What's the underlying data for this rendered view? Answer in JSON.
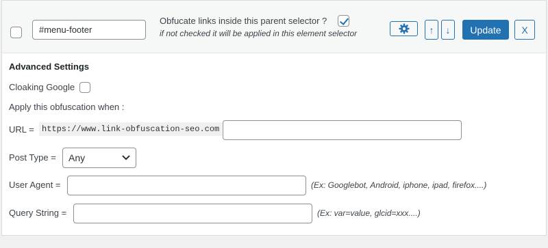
{
  "row": {
    "selector_value": "#menu-footer",
    "parent_selector_label": "Obfucate links inside this parent selector ?",
    "parent_selector_hint": "if not checked it will be applied in this element selector",
    "parent_selector_checked": true,
    "update_label": "Update",
    "close_label": "X",
    "up_arrow": "↑",
    "down_arrow": "↓",
    "settings_icon": "gear-icon"
  },
  "advanced": {
    "heading": "Advanced Settings",
    "cloaking_label": "Cloaking Google",
    "cloaking_checked": false,
    "apply_when_label": "Apply this obfuscation when :",
    "url_label": "URL =",
    "url_prefix": "https://www.link-obfuscation-seo.com",
    "url_value": "",
    "post_type_label": "Post Type =",
    "post_type_selected": "Any",
    "user_agent_label": "User Agent =",
    "user_agent_value": "",
    "user_agent_hint": "(Ex: Googlebot, Android, iphone, ipad, firefox....)",
    "query_string_label": "Query String =",
    "query_string_value": "",
    "query_string_hint": "(Ex: var=value, glcid=xxx....)"
  },
  "colors": {
    "accent": "#2271b1",
    "panel_bg": "#ffffff",
    "row_bg": "#f6f7f7",
    "page_bg": "#f0f0f1"
  }
}
